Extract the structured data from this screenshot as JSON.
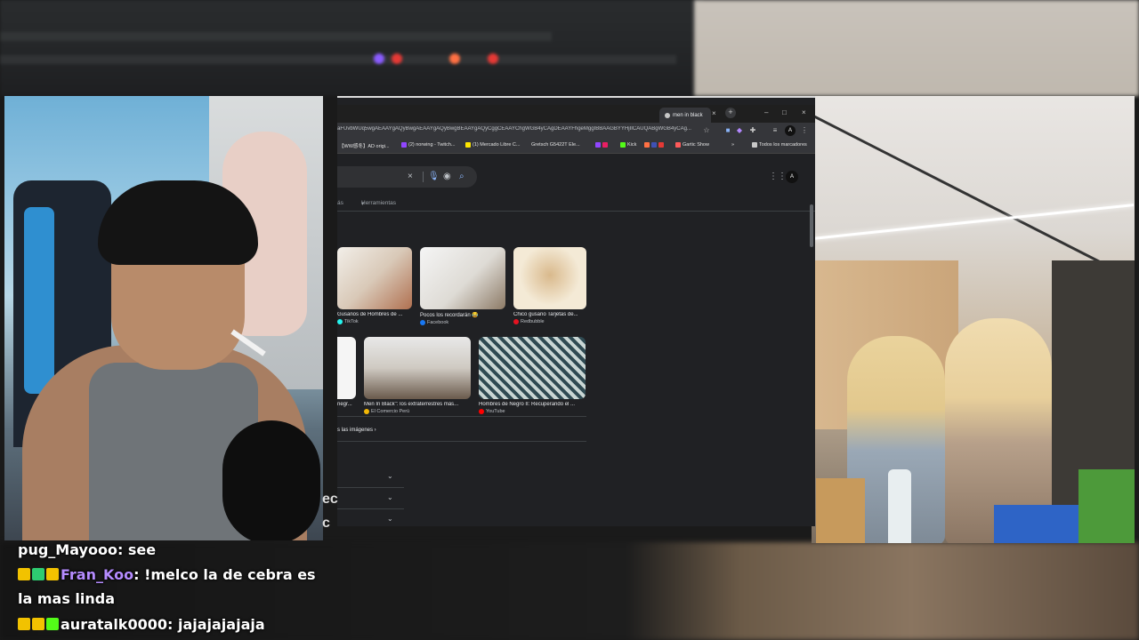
{
  "browser": {
    "tab_title": "men in black",
    "tab_close": "×",
    "new_tab": "+",
    "window_controls": {
      "minimize": "–",
      "maximize": "□",
      "close": "×"
    },
    "url": "aFUvbWUq5wgAEAAYgAQyBwgAEAAYgAQyBwgBEAAYgAQyCggCEAAYChgWGB4yCAgDEAAYFhgeMggIBBAAGBYYHjIICAUQABgWGB4yCAg...",
    "profile_initial": "A",
    "bookmarks": [
      {
        "label": "【WW感冬】AD origi...",
        "color": "#e8e8e8"
      },
      {
        "label": "(2) norwing - Twitch...",
        "color": "#9146ff"
      },
      {
        "label": "(1) Mercado Libre C...",
        "color": "#ffe600"
      },
      {
        "label": "Gretsch G5422T Ele...",
        "color": "#e8e8e8"
      },
      {
        "label": "Kick",
        "color": "#53fc18"
      },
      {
        "label": "Gartic Show",
        "color": "#ff5a5a"
      },
      {
        "label": "»",
        "color": ""
      },
      {
        "label": "Todos los marcadores",
        "color": "#c8c8c8"
      }
    ]
  },
  "search": {
    "clear_icon": "×",
    "filters": [
      "ás",
      "Herramientas"
    ]
  },
  "images": {
    "row1": [
      {
        "title": "Gusanos de Hombres de ...",
        "source": "TikTok",
        "source_color": "#25f4ee"
      },
      {
        "title": "Pocos los recordarán 😂",
        "source": "Facebook",
        "source_color": "#1877f2"
      },
      {
        "title": "Chico gusano Tarjetas de...",
        "source": "Redbubble",
        "source_color": "#e41321"
      }
    ],
    "row2": [
      {
        "title": "negr...",
        "source": "",
        "source_color": ""
      },
      {
        "title": "Men In Black\": los extraterrestres más...",
        "source": "El Comercio Perú",
        "source_color": "#f2b705"
      },
      {
        "title": "Hombres de Negro II: Recuperando el ...",
        "source": "YouTube",
        "source_color": "#ff0000"
      }
    ],
    "see_all": "s las imágenes ›"
  },
  "chat": [
    {
      "user": "pug_Mayooo",
      "user_color": "#ffffff",
      "message": "see",
      "badges": []
    },
    {
      "user": "Fran_Koo",
      "user_color": "#b58cff",
      "message": "!melco la de cebra es",
      "message_cont": "la mas linda",
      "badges": [
        "#f2c200",
        "#2ecc71",
        "#f2c200"
      ]
    },
    {
      "user": "auratalk0000",
      "user_color": "#ffffff",
      "message": "jajajajajaja",
      "badges": [
        "#f2c200",
        "#f2c200",
        "#53fc18"
      ]
    }
  ],
  "chat_edge": [
    "ec",
    "c"
  ]
}
